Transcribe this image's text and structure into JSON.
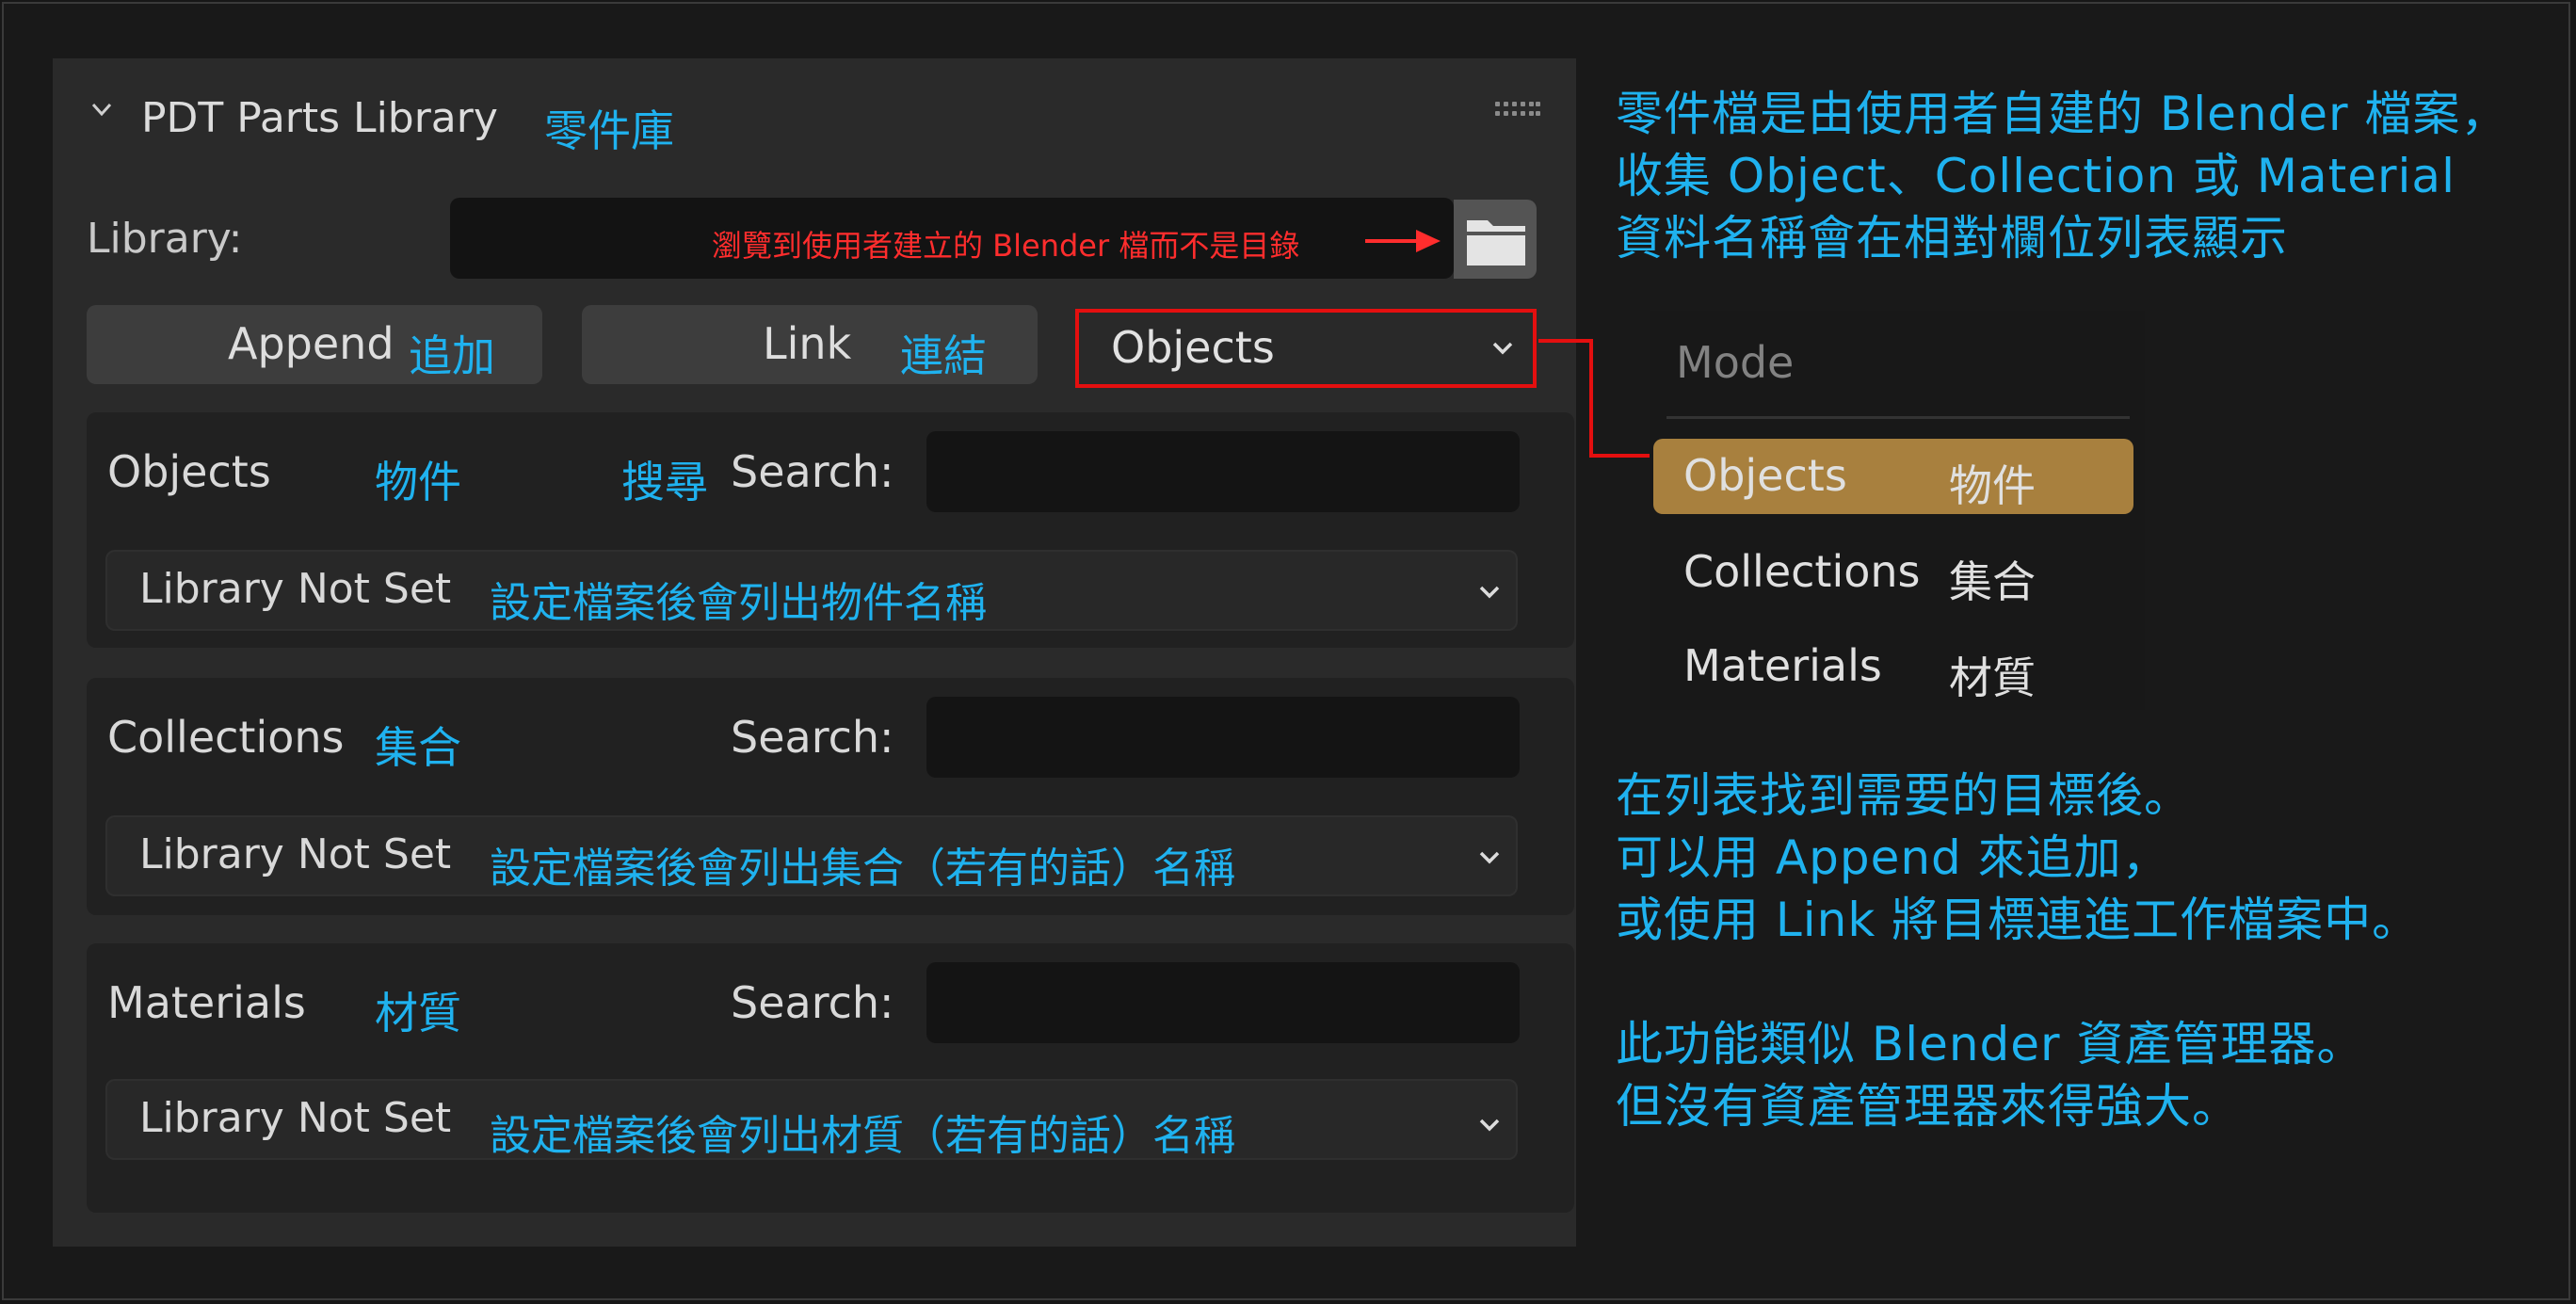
{
  "panel": {
    "title": "PDT Parts Library",
    "title_cn": "零件庫",
    "library_label": "Library:",
    "library_value": "",
    "library_note": "瀏覽到使用者建立的 Blender 檔而不是目錄",
    "append_label": "Append",
    "append_cn": "追加",
    "link_label": "Link",
    "link_cn": "連結",
    "mode_selected": "Objects"
  },
  "sections": {
    "objects": {
      "label": "Objects",
      "label_cn": "物件",
      "search_cn": "搜尋",
      "search_label": "Search:",
      "list_value": "Library Not Set",
      "list_note": "設定檔案後會列出物件名稱"
    },
    "collections": {
      "label": "Collections",
      "label_cn": "集合",
      "search_label": "Search:",
      "list_value": "Library Not Set",
      "list_note": "設定檔案後會列出集合（若有的話）名稱"
    },
    "materials": {
      "label": "Materials",
      "label_cn": "材質",
      "search_label": "Search:",
      "list_value": "Library Not Set",
      "list_note": "設定檔案後會列出材質（若有的話）名稱"
    }
  },
  "annotations": {
    "top": [
      "零件檔是由使用者自建的 Blender 檔案，",
      "收集 Object、Collection 或 Material",
      "資料名稱會在相對欄位列表顯示"
    ],
    "middle": [
      "在列表找到需要的目標後。",
      "可以用 Append 來追加，",
      "或使用 Link 將目標連進工作檔案中。"
    ],
    "bottom": [
      "此功能類似 Blender 資產管理器。",
      "但沒有資產管理器來得強大。"
    ]
  },
  "mode_menu": {
    "title": "Mode",
    "items": [
      {
        "label": "Objects",
        "label_cn": "物件",
        "selected": true
      },
      {
        "label": "Collections",
        "label_cn": "集合",
        "selected": false
      },
      {
        "label": "Materials",
        "label_cn": "材質",
        "selected": false
      }
    ]
  },
  "colors": {
    "accent_cyan": "#1fb2ef",
    "highlight_red": "#e40f0f",
    "selected_item": "#a8803e"
  },
  "icons": [
    "chevron-down-icon",
    "folder-icon",
    "arrow-right-icon",
    "drag-grip-icon"
  ]
}
